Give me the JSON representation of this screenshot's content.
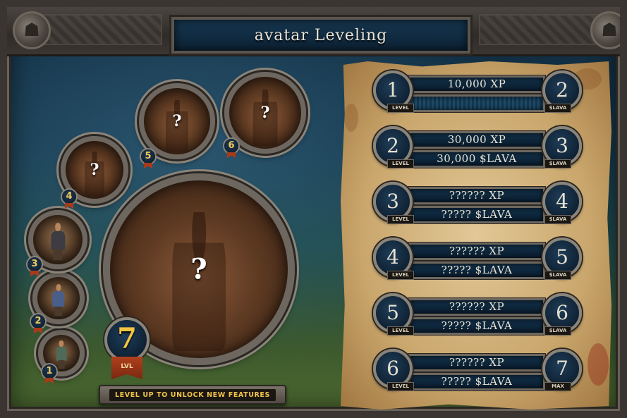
{
  "title": "avatar Leveling",
  "current_level": {
    "value": "7",
    "label": "LVL"
  },
  "unlock_message": "LEVEL UP TO UNLOCK NEW FEATURES",
  "avatars": [
    {
      "badge": "1",
      "state": "unlocked",
      "outfit_color": "#4f6a58"
    },
    {
      "badge": "2",
      "state": "unlocked",
      "outfit_color": "#4a5e8a"
    },
    {
      "badge": "3",
      "state": "unlocked",
      "outfit_color": "#3c3c42"
    },
    {
      "badge": "4",
      "state": "locked",
      "mark": "?"
    },
    {
      "badge": "5",
      "state": "locked",
      "mark": "?"
    },
    {
      "badge": "6",
      "state": "locked",
      "mark": "?"
    },
    {
      "badge": "7",
      "state": "locked",
      "mark": "?"
    }
  ],
  "levels": [
    {
      "from": "1",
      "to": "2",
      "xp": "10,000 XP",
      "lava": "",
      "left_tag": "LEVEL",
      "right_tag": "$LAVA"
    },
    {
      "from": "2",
      "to": "3",
      "xp": "30,000 XP",
      "lava": "30,000 $LAVA",
      "left_tag": "LEVEL",
      "right_tag": "$LAVA"
    },
    {
      "from": "3",
      "to": "4",
      "xp": "?????? XP",
      "lava": "????? $LAVA",
      "left_tag": "LEVEL",
      "right_tag": "$LAVA"
    },
    {
      "from": "4",
      "to": "5",
      "xp": "?????? XP",
      "lava": "????? $LAVA",
      "left_tag": "LEVEL",
      "right_tag": "$LAVA"
    },
    {
      "from": "5",
      "to": "6",
      "xp": "?????? XP",
      "lava": "????? $LAVA",
      "left_tag": "LEVEL",
      "right_tag": "$LAVA"
    },
    {
      "from": "6",
      "to": "7",
      "xp": "?????? XP",
      "lava": "????? $LAVA",
      "left_tag": "LEVEL",
      "right_tag": "MAX"
    }
  ],
  "colors": {
    "accent_gold": "#f3c443",
    "ribbon_red": "#a83a1a",
    "panel_blue": "#0c2234",
    "parchment": "#d8b880"
  }
}
